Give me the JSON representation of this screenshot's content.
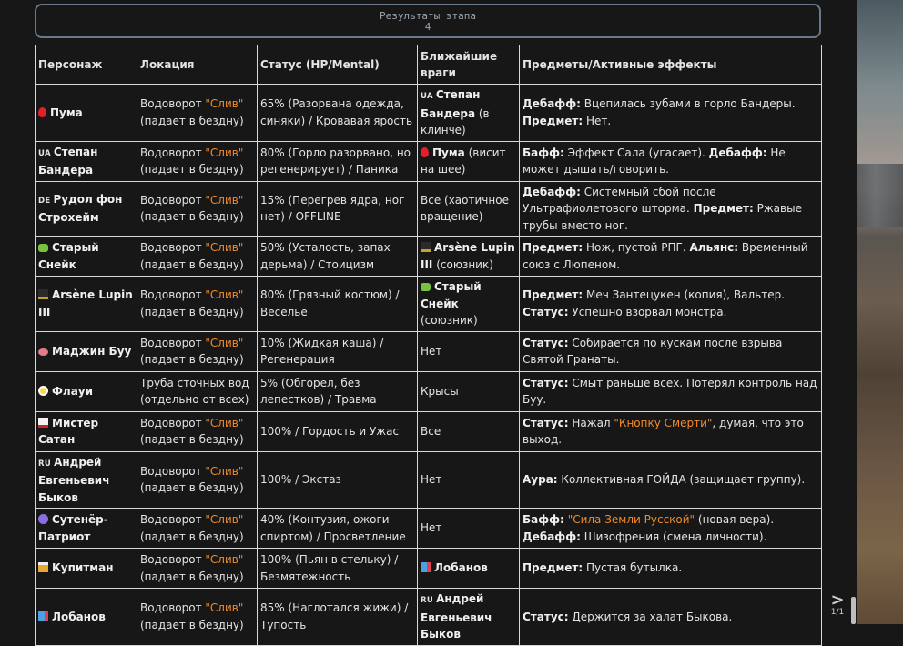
{
  "header": {
    "title": "Результаты этапа",
    "number": "4"
  },
  "columns": [
    "Персонаж",
    "Локация",
    "Статус (HP/Mental)",
    "Ближайшие враги",
    "Предметы/Активные эффекты"
  ],
  "colors": {
    "accent": "#f08a2a",
    "border": "#d8d8d8",
    "background": "#171717"
  },
  "rows": [
    {
      "char": [
        {
          "icon": "blood-drop"
        },
        {
          "t": "Пума",
          "b": 1
        }
      ],
      "loc": [
        {
          "t": "Водоворот "
        },
        {
          "t": "\"Слив\"",
          "o": 1
        },
        {
          "t": " (падает в бездну)"
        }
      ],
      "status": [
        {
          "t": "65% (Разорвана одежда, синяки) / Кровавая ярость"
        }
      ],
      "enemy": [
        {
          "flag": "UA"
        },
        {
          "t": "Степан Бандера",
          "b": 1
        },
        {
          "t": " (в клинче)"
        }
      ],
      "fx": [
        {
          "t": "Дебафф:",
          "b": 1
        },
        {
          "t": " Вцепилась зубами в горло Бандеры. "
        },
        {
          "t": "Предмет:",
          "b": 1
        },
        {
          "t": " Нет."
        }
      ]
    },
    {
      "char": [
        {
          "flag": "UA"
        },
        {
          "t": "Степан Бандера",
          "b": 1
        }
      ],
      "loc": [
        {
          "t": "Водоворот "
        },
        {
          "t": "\"Слив\"",
          "o": 1
        },
        {
          "t": " (падает в бездну)"
        }
      ],
      "status": [
        {
          "t": "80% (Горло разорвано, но регенерирует) / Паника"
        }
      ],
      "enemy": [
        {
          "icon": "blood-drop"
        },
        {
          "t": "Пума",
          "b": 1
        },
        {
          "t": " (висит на шее)"
        }
      ],
      "fx": [
        {
          "t": "Бафф:",
          "b": 1
        },
        {
          "t": " Эффект Сала (угасает). "
        },
        {
          "t": "Дебафф:",
          "b": 1
        },
        {
          "t": " Не может дышать/говорить."
        }
      ]
    },
    {
      "char": [
        {
          "flag": "DE"
        },
        {
          "t": "Рудол фон Строхейм",
          "b": 1
        }
      ],
      "loc": [
        {
          "t": "Водоворот "
        },
        {
          "t": "\"Слив\"",
          "o": 1
        },
        {
          "t": " (падает в бездну)"
        }
      ],
      "status": [
        {
          "t": "15% (Перегрев ядра, ног нет) / OFFLINE"
        }
      ],
      "enemy": [
        {
          "t": "Все (хаотичное вращение)"
        }
      ],
      "fx": [
        {
          "t": "Дебафф:",
          "b": 1
        },
        {
          "t": " Системный сбой после Ультрафиолетового шторма. "
        },
        {
          "t": "Предмет:",
          "b": 1
        },
        {
          "t": " Ржавые трубы вместо ног."
        }
      ]
    },
    {
      "char": [
        {
          "icon": "snake"
        },
        {
          "t": "Старый Снейк",
          "b": 1
        }
      ],
      "loc": [
        {
          "t": "Водоворот "
        },
        {
          "t": "\"Слив\"",
          "o": 1
        },
        {
          "t": " (падает в бездну)"
        }
      ],
      "status": [
        {
          "t": "50% (Усталость, запах дерьма) / Стоицизм"
        }
      ],
      "enemy": [
        {
          "icon": "top-hat"
        },
        {
          "t": "Arsène Lupin III",
          "b": 1
        },
        {
          "t": " (союзник)"
        }
      ],
      "fx": [
        {
          "t": "Предмет:",
          "b": 1
        },
        {
          "t": " Нож, пустой РПГ. "
        },
        {
          "t": "Альянс:",
          "b": 1
        },
        {
          "t": " Временный союз с Люпеном."
        }
      ]
    },
    {
      "char": [
        {
          "icon": "top-hat"
        },
        {
          "t": "Arsène Lupin III",
          "b": 1
        }
      ],
      "loc": [
        {
          "t": "Водоворот "
        },
        {
          "t": "\"Слив\"",
          "o": 1
        },
        {
          "t": " (падает в бездну)"
        }
      ],
      "status": [
        {
          "t": "80% (Грязный костюм) / Веселье"
        }
      ],
      "enemy": [
        {
          "icon": "snake"
        },
        {
          "t": "Старый Снейк",
          "b": 1
        },
        {
          "t": " (союзник)"
        }
      ],
      "fx": [
        {
          "t": "Предмет:",
          "b": 1
        },
        {
          "t": " Меч Зантецукен (копия), Вальтер. "
        },
        {
          "t": "Статус:",
          "b": 1
        },
        {
          "t": " Успешно взорвал монстра."
        }
      ]
    },
    {
      "char": [
        {
          "icon": "pink-blob"
        },
        {
          "t": "Маджин Буу",
          "b": 1
        }
      ],
      "loc": [
        {
          "t": "Водоворот "
        },
        {
          "t": "\"Слив\"",
          "o": 1
        },
        {
          "t": " (падает в бездну)"
        }
      ],
      "status": [
        {
          "t": "10% (Жидкая каша) / Регенерация"
        }
      ],
      "enemy": [
        {
          "t": "Нет"
        }
      ],
      "fx": [
        {
          "t": "Статус:",
          "b": 1
        },
        {
          "t": " Собирается по кускам после взрыва Святой Гранаты."
        }
      ]
    },
    {
      "char": [
        {
          "icon": "flower"
        },
        {
          "t": "Флауи",
          "b": 1
        }
      ],
      "loc": [
        {
          "t": "Труба сточных вод (отдельно от всех)"
        }
      ],
      "status": [
        {
          "t": "5% (Обгорел, без лепестков) / Травма"
        }
      ],
      "enemy": [
        {
          "t": "Крысы"
        }
      ],
      "fx": [
        {
          "t": "Статус:",
          "b": 1
        },
        {
          "t": " Смыт раньше всех. Потерял контроль над Буу."
        }
      ]
    },
    {
      "char": [
        {
          "icon": "martial-arts-uniform"
        },
        {
          "t": "Мистер Сатан",
          "b": 1
        }
      ],
      "loc": [
        {
          "t": "Водоворот "
        },
        {
          "t": "\"Слив\"",
          "o": 1
        },
        {
          "t": " (падает в бездну)"
        }
      ],
      "status": [
        {
          "t": "100% / Гордость и Ужас"
        }
      ],
      "enemy": [
        {
          "t": "Все"
        }
      ],
      "fx": [
        {
          "t": "Статус:",
          "b": 1
        },
        {
          "t": " Нажал "
        },
        {
          "t": "\"Кнопку Смерти\"",
          "o": 1
        },
        {
          "t": ", думая, что это выход."
        }
      ]
    },
    {
      "char": [
        {
          "flag": "RU"
        },
        {
          "t": "Андрей Евгеньевич Быков",
          "b": 1
        }
      ],
      "loc": [
        {
          "t": "Водоворот "
        },
        {
          "t": "\"Слив\"",
          "o": 1
        },
        {
          "t": " (падает в бездну)"
        }
      ],
      "status": [
        {
          "t": "100% / Экстаз"
        }
      ],
      "enemy": [
        {
          "t": "Нет"
        }
      ],
      "fx": [
        {
          "t": "Аура:",
          "b": 1
        },
        {
          "t": " Коллективная ГОЙДА (защищает группу)."
        }
      ]
    },
    {
      "char": [
        {
          "icon": "purple-circle"
        },
        {
          "t": "Сутенёр-Патриот",
          "b": 1
        }
      ],
      "loc": [
        {
          "t": "Водоворот "
        },
        {
          "t": "\"Слив\"",
          "o": 1
        },
        {
          "t": " (падает в бездну)"
        }
      ],
      "status": [
        {
          "t": "40% (Контузия, ожоги спиртом) / Просветление"
        }
      ],
      "enemy": [
        {
          "t": "Нет"
        }
      ],
      "fx": [
        {
          "t": "Бафф:",
          "b": 1
        },
        {
          "t": " "
        },
        {
          "t": "\"Сила Земли Русской\"",
          "o": 1
        },
        {
          "t": " (новая вера). "
        },
        {
          "t": "Дебафф:",
          "b": 1
        },
        {
          "t": " Шизофрения (смена личности)."
        }
      ]
    },
    {
      "char": [
        {
          "icon": "whisky-glass"
        },
        {
          "t": "Купитман",
          "b": 1
        }
      ],
      "loc": [
        {
          "t": "Водоворот "
        },
        {
          "t": "\"Слив\"",
          "o": 1
        },
        {
          "t": " (падает в бездну)"
        }
      ],
      "status": [
        {
          "t": "100% (Пьян в стельку) / Безмятежность"
        }
      ],
      "enemy": [
        {
          "icon": "building"
        },
        {
          "t": "Лобанов",
          "b": 1
        }
      ],
      "fx": [
        {
          "t": "Предмет:",
          "b": 1
        },
        {
          "t": " Пустая бутылка."
        }
      ]
    },
    {
      "char": [
        {
          "icon": "building"
        },
        {
          "t": "Лобанов",
          "b": 1
        }
      ],
      "loc": [
        {
          "t": "Водоворот "
        },
        {
          "t": "\"Слив\"",
          "o": 1
        },
        {
          "t": " (падает в бездну)"
        }
      ],
      "status": [
        {
          "t": "85% (Наглотался жижи) / Тупость"
        }
      ],
      "enemy": [
        {
          "flag": "RU"
        },
        {
          "t": "Андрей Евгеньевич Быков",
          "b": 1
        }
      ],
      "fx": [
        {
          "t": "Статус:",
          "b": 1
        },
        {
          "t": " Держится за халат Быкова."
        }
      ]
    }
  ],
  "pager": {
    "next_icon": "chevron-right-icon",
    "page": "1/1"
  }
}
